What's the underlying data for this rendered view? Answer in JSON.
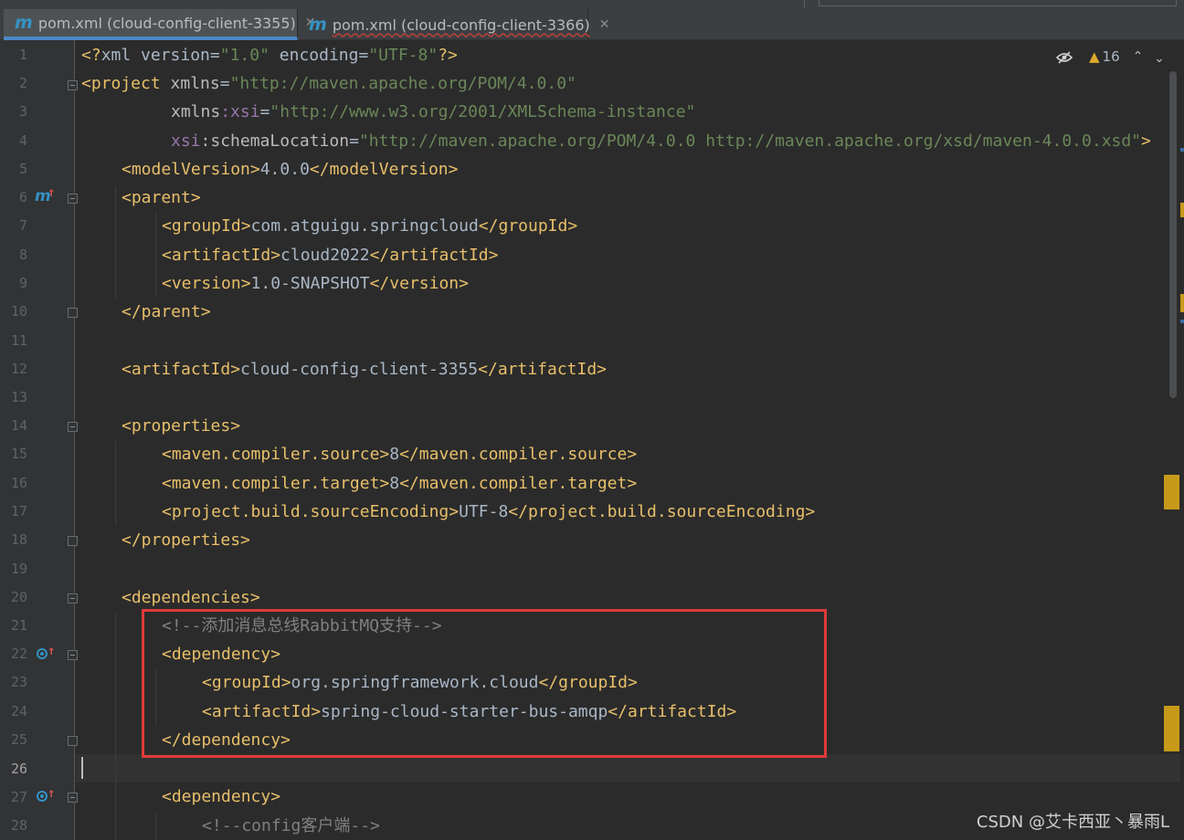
{
  "tabs": [
    {
      "label": "pom.xml (cloud-config-client-3355)",
      "icon": "maven-icon",
      "active": true
    },
    {
      "label": "pom.xml (cloud-config-client-3366)",
      "icon": "maven-icon",
      "active": false
    }
  ],
  "inspection": {
    "warning_count": "16",
    "icons": [
      "hide-eye-icon",
      "warning-icon",
      "chevron-up-icon",
      "chevron-down-icon"
    ]
  },
  "line_numbers": [
    "1",
    "2",
    "3",
    "4",
    "5",
    "6",
    "7",
    "8",
    "9",
    "10",
    "11",
    "12",
    "13",
    "14",
    "15",
    "16",
    "17",
    "18",
    "19",
    "20",
    "21",
    "22",
    "23",
    "24",
    "25",
    "26",
    "27",
    "28"
  ],
  "current_line": "26",
  "code": {
    "l1": {
      "p1": "<?",
      "p2": "xml version",
      "p3": "=",
      "p4": "\"1.0\"",
      "p5": " encoding",
      "p6": "=",
      "p7": "\"UTF-8\"",
      "p8": "?>"
    },
    "l2": {
      "p1": "<project ",
      "p2": "xmlns",
      "p3": "=",
      "p4": "\"http://maven.apache.org/POM/4.0.0\""
    },
    "l3": {
      "p1": "xmlns",
      "p2": ":xsi",
      "p3": "=",
      "p4": "\"http://www.w3.org/2001/XMLSchema-instance\""
    },
    "l4": {
      "p1": "xsi",
      "p2": ":schemaLocation",
      "p3": "=",
      "p4": "\"http://maven.apache.org/POM/4.0.0 http://maven.apache.org/xsd/maven-4.0.0.xsd\"",
      "p5": ">"
    },
    "l5": {
      "open": "<modelVersion>",
      "text": "4.0.0",
      "close": "</modelVersion>"
    },
    "l6": {
      "open": "<parent>"
    },
    "l7": {
      "open": "<groupId>",
      "text": "com.atguigu.springcloud",
      "close": "</groupId>"
    },
    "l8": {
      "open": "<artifactId>",
      "text": "cloud2022",
      "close": "</artifactId>"
    },
    "l9": {
      "open": "<version>",
      "text": "1.0-SNAPSHOT",
      "close": "</version>"
    },
    "l10": {
      "close": "</parent>"
    },
    "l12": {
      "open": "<artifactId>",
      "text": "cloud-config-client-3355",
      "close": "</artifactId>"
    },
    "l14": {
      "open": "<properties>"
    },
    "l15": {
      "open": "<maven.compiler.source>",
      "text": "8",
      "close": "</maven.compiler.source>"
    },
    "l16": {
      "open": "<maven.compiler.target>",
      "text": "8",
      "close": "</maven.compiler.target>"
    },
    "l17": {
      "open": "<project.build.sourceEncoding>",
      "text": "UTF-8",
      "close": "</project.build.sourceEncoding>"
    },
    "l18": {
      "close": "</properties>"
    },
    "l20": {
      "open": "<dependencies>"
    },
    "l21": {
      "comment": "<!--添加消息总线RabbitMQ支持-->"
    },
    "l22": {
      "open": "<dependency>"
    },
    "l23": {
      "open": "<groupId>",
      "text": "org.springframework.cloud",
      "close": "</groupId>"
    },
    "l24": {
      "open": "<artifactId>",
      "text": "spring-cloud-starter-bus-amqp",
      "close": "</artifactId>"
    },
    "l25": {
      "close": "</dependency>"
    },
    "l27": {
      "open": "<dependency>"
    },
    "l28": {
      "comment": "<!--config客户端-->"
    }
  },
  "colors": {
    "editor_bg": "#2b2b2b",
    "tag": "#e8bf6a",
    "attr_value": "#6a8759",
    "namespace": "#9876aa",
    "text": "#a9b7c6",
    "comment": "#808080",
    "highlight_box": "#e03a3a"
  },
  "watermark": "CSDN @艾卡西亚丶暴雨L"
}
